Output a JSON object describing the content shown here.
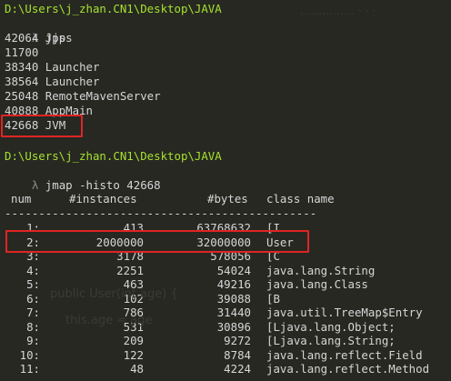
{
  "session1": {
    "prompt_path": "D:\\Users\\j_zhan.CN1\\Desktop\\JAVA",
    "prompt_symbol": "λ",
    "command": "jjps",
    "processes": [
      {
        "pid": "42064",
        "name": "Jps"
      },
      {
        "pid": "11700",
        "name": ""
      },
      {
        "pid": "38340",
        "name": "Launcher"
      },
      {
        "pid": "38564",
        "name": "Launcher"
      },
      {
        "pid": "25048",
        "name": "RemoteMavenServer"
      },
      {
        "pid": "40888",
        "name": "AppMain"
      },
      {
        "pid": "42668",
        "name": "JVM"
      }
    ]
  },
  "session2": {
    "prompt_path": "D:\\Users\\j_zhan.CN1\\Desktop\\JAVA",
    "prompt_symbol": "λ",
    "command": "jmap -histo 42668",
    "headers": {
      "num": "num",
      "instances": "#instances",
      "bytes": "#bytes",
      "class": "class name"
    },
    "separator": "----------------------------------------------",
    "rows": [
      {
        "num": "1:",
        "instances": "413",
        "bytes": "63768632",
        "class": "[I"
      },
      {
        "num": "2:",
        "instances": "2000000",
        "bytes": "32000000",
        "class": "User"
      },
      {
        "num": "3:",
        "instances": "3178",
        "bytes": "578056",
        "class": "[C"
      },
      {
        "num": "4:",
        "instances": "2251",
        "bytes": "54024",
        "class": "java.lang.String"
      },
      {
        "num": "5:",
        "instances": "463",
        "bytes": "49216",
        "class": "java.lang.Class"
      },
      {
        "num": "6:",
        "instances": "102",
        "bytes": "39088",
        "class": "[B"
      },
      {
        "num": "7:",
        "instances": "786",
        "bytes": "31440",
        "class": "java.util.TreeMap$Entry"
      },
      {
        "num": "8:",
        "instances": "531",
        "bytes": "30896",
        "class": "[Ljava.lang.Object;"
      },
      {
        "num": "9:",
        "instances": "209",
        "bytes": "9272",
        "class": "[Ljava.lang.String;"
      },
      {
        "num": "10:",
        "instances": "122",
        "bytes": "8784",
        "class": "java.lang.reflect.Field"
      },
      {
        "num": "11:",
        "instances": "48",
        "bytes": "4224",
        "class": "java.lang.reflect.Method"
      }
    ]
  },
  "colors": {
    "background": "#272822",
    "prompt_path": "#a6e22e",
    "text": "#d6d6d6",
    "highlight_box": "#e02424"
  }
}
